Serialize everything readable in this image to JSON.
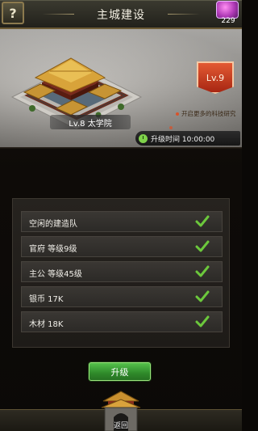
{
  "header": {
    "help_label": "?",
    "title": "主城建设",
    "gem_count": "229"
  },
  "building": {
    "name": "Lv.8 太学院",
    "next_level": "Lv.9",
    "unlock_text": "开启更多的科技研究",
    "upgrade_time": "升级时间 10:00:00"
  },
  "requirements": [
    {
      "label": "空闲的建造队",
      "met": true
    },
    {
      "label": "官府 等级9级",
      "met": true
    },
    {
      "label": "主公 等级45级",
      "met": true
    },
    {
      "label": "银币 17K",
      "met": true
    },
    {
      "label": "木材 18K",
      "met": true
    }
  ],
  "actions": {
    "upgrade_label": "升级",
    "return_label": "返回"
  },
  "colors": {
    "check": "#6cc83c",
    "upgrade_button": "#3a9c33",
    "level_badge": "#c2391c"
  },
  "icons": {
    "help": "question-mark-icon",
    "gem": "gem-icon",
    "clock": "clock-icon",
    "check": "check-icon",
    "return": "gate-icon"
  }
}
